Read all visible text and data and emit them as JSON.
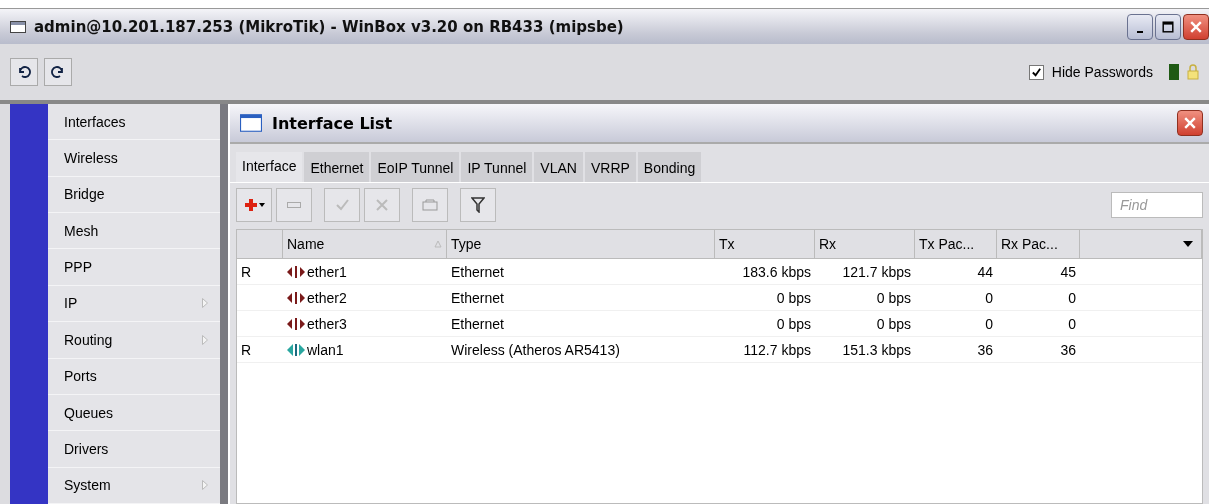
{
  "window": {
    "title": "admin@10.201.187.253 (MikroTik) - WinBox v3.20 on RB433 (mipsbe)"
  },
  "toolbar": {
    "hide_passwords": {
      "label": "Hide Passwords",
      "checked": true
    }
  },
  "sidebar": {
    "items": [
      {
        "label": "Interfaces",
        "submenu": false
      },
      {
        "label": "Wireless",
        "submenu": false
      },
      {
        "label": "Bridge",
        "submenu": false
      },
      {
        "label": "Mesh",
        "submenu": false
      },
      {
        "label": "PPP",
        "submenu": false
      },
      {
        "label": "IP",
        "submenu": true
      },
      {
        "label": "Routing",
        "submenu": true
      },
      {
        "label": "Ports",
        "submenu": false
      },
      {
        "label": "Queues",
        "submenu": false
      },
      {
        "label": "Drivers",
        "submenu": false
      },
      {
        "label": "System",
        "submenu": true
      }
    ]
  },
  "interface_list": {
    "title": "Interface List",
    "tabs": [
      {
        "label": "Interface",
        "selected": true
      },
      {
        "label": "Ethernet",
        "selected": false
      },
      {
        "label": "EoIP Tunnel",
        "selected": false
      },
      {
        "label": "IP Tunnel",
        "selected": false
      },
      {
        "label": "VLAN",
        "selected": false
      },
      {
        "label": "VRRP",
        "selected": false
      },
      {
        "label": "Bonding",
        "selected": false
      }
    ],
    "find": {
      "placeholder": "Find"
    },
    "table": {
      "columns": [
        "Name",
        "Type",
        "Tx",
        "Rx",
        "Tx Pac...",
        "Rx Pac..."
      ],
      "rows": [
        {
          "flag": "R",
          "kind": "ethernet",
          "name": "ether1",
          "type": "Ethernet",
          "tx": "183.6 kbps",
          "rx": "121.7 kbps",
          "tx_packets": "44",
          "rx_packets": "45"
        },
        {
          "kind": "ethernet",
          "name": "ether2",
          "type": "Ethernet",
          "tx": "0 bps",
          "rx": "0 bps",
          "tx_packets": "0",
          "rx_packets": "0"
        },
        {
          "kind": "ethernet",
          "name": "ether3",
          "type": "Ethernet",
          "tx": "0 bps",
          "rx": "0 bps",
          "tx_packets": "0",
          "rx_packets": "0"
        },
        {
          "flag": "R",
          "kind": "wireless",
          "name": "wlan1",
          "type": "Wireless (Atheros AR5413)",
          "tx": "112.7 kbps",
          "rx": "151.3 kbps",
          "tx_packets": "36",
          "rx_packets": "36"
        }
      ]
    }
  }
}
